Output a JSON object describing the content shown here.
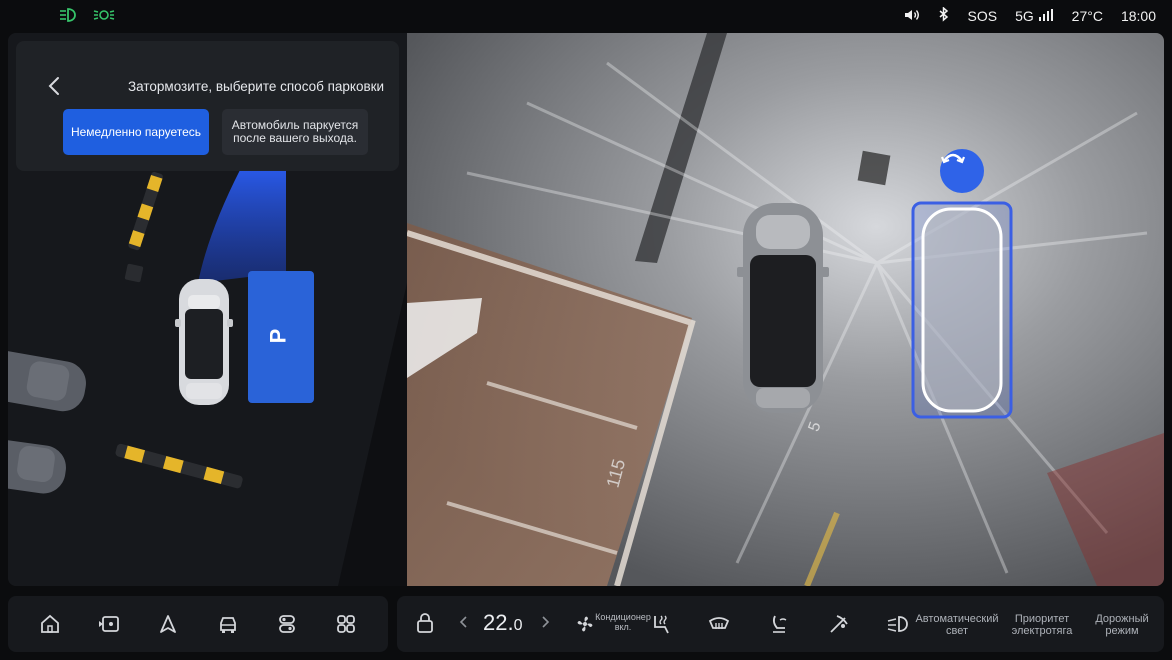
{
  "status_bar": {
    "left_icons": [
      "low-beam-icon",
      "parking-lights-icon"
    ],
    "sound_icon": "volume-icon",
    "bluetooth_icon": "bluetooth-icon",
    "sos": "SOS",
    "network": "5G",
    "temperature": "27°C",
    "time": "18:00"
  },
  "parking_prompt": {
    "title": "Затормозите, выберите способ парковки",
    "options": [
      {
        "label": "Немедленно паруетесь",
        "selected": true
      },
      {
        "label": "Автомобиль паркуется после вашего выхода.",
        "selected": false
      }
    ]
  },
  "map_view": {
    "spot_marker": "P",
    "colors": {
      "accent": "#1f5fe0",
      "spot": "#2a63d8",
      "barrier_yellow": "#e5b52a"
    }
  },
  "camera_view": {
    "floor_numbers": [
      "5",
      "115"
    ],
    "selected_slot_icon": "rotate-icon"
  },
  "dock": {
    "nav_icons": [
      "home-icon",
      "media-icon",
      "navigation-icon",
      "car-icon",
      "settings-icon",
      "apps-icon"
    ],
    "climate": {
      "temperature_whole": "22.",
      "temperature_decimal": "0",
      "ac_label": "Кондиционер вкл."
    },
    "labels": {
      "auto_light": "Автоматический свет",
      "ev_priority": "Приоритет электротяга",
      "drive_mode": "Дорожный режим"
    }
  }
}
